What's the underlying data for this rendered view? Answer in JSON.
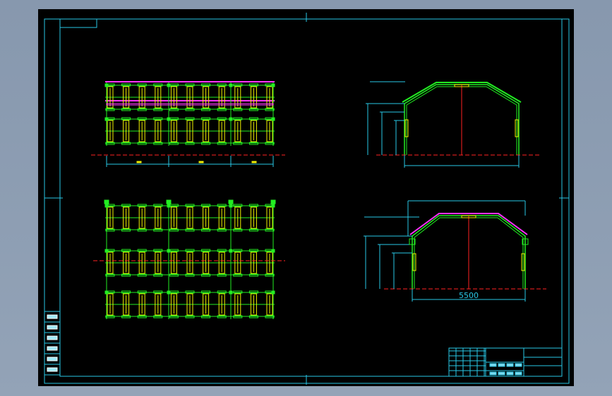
{
  "drawing": {
    "dimension_label": "5500",
    "colors": {
      "background": "#000000",
      "frame": "#29c7e6",
      "structure": "#22ee22",
      "member": "#f0f000",
      "roof": "#ff33ff",
      "centerline": "#ff2222"
    }
  },
  "views": [
    {
      "name": "plan-view-top",
      "kind": "frame-grid"
    },
    {
      "name": "plan-view-bottom",
      "kind": "frame-grid"
    },
    {
      "name": "elevation-view-top",
      "kind": "section"
    },
    {
      "name": "elevation-view-bottom",
      "kind": "section"
    }
  ],
  "title_block": {
    "revision_rows": 5,
    "sign_rows": 6
  }
}
